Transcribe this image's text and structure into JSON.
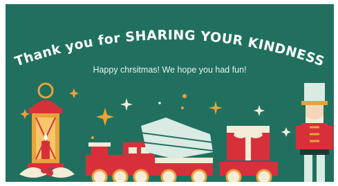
{
  "card": {
    "title": "Thank you for SHARING YOUR KINDNESS",
    "subtitle": "Happy chrsitmas! We hope you had fun!"
  },
  "colors": {
    "background": "#21705f",
    "red": "#d8303a",
    "gold": "#e8a33b",
    "cream": "#f4ecd6",
    "snow": "#d9ebe3"
  },
  "icons": [
    "sparkle-icon",
    "lantern-icon",
    "candle-icon",
    "toy-train-icon",
    "christmas-tree-icon",
    "gift-box-icon",
    "nutcracker-icon",
    "holly-icon"
  ]
}
